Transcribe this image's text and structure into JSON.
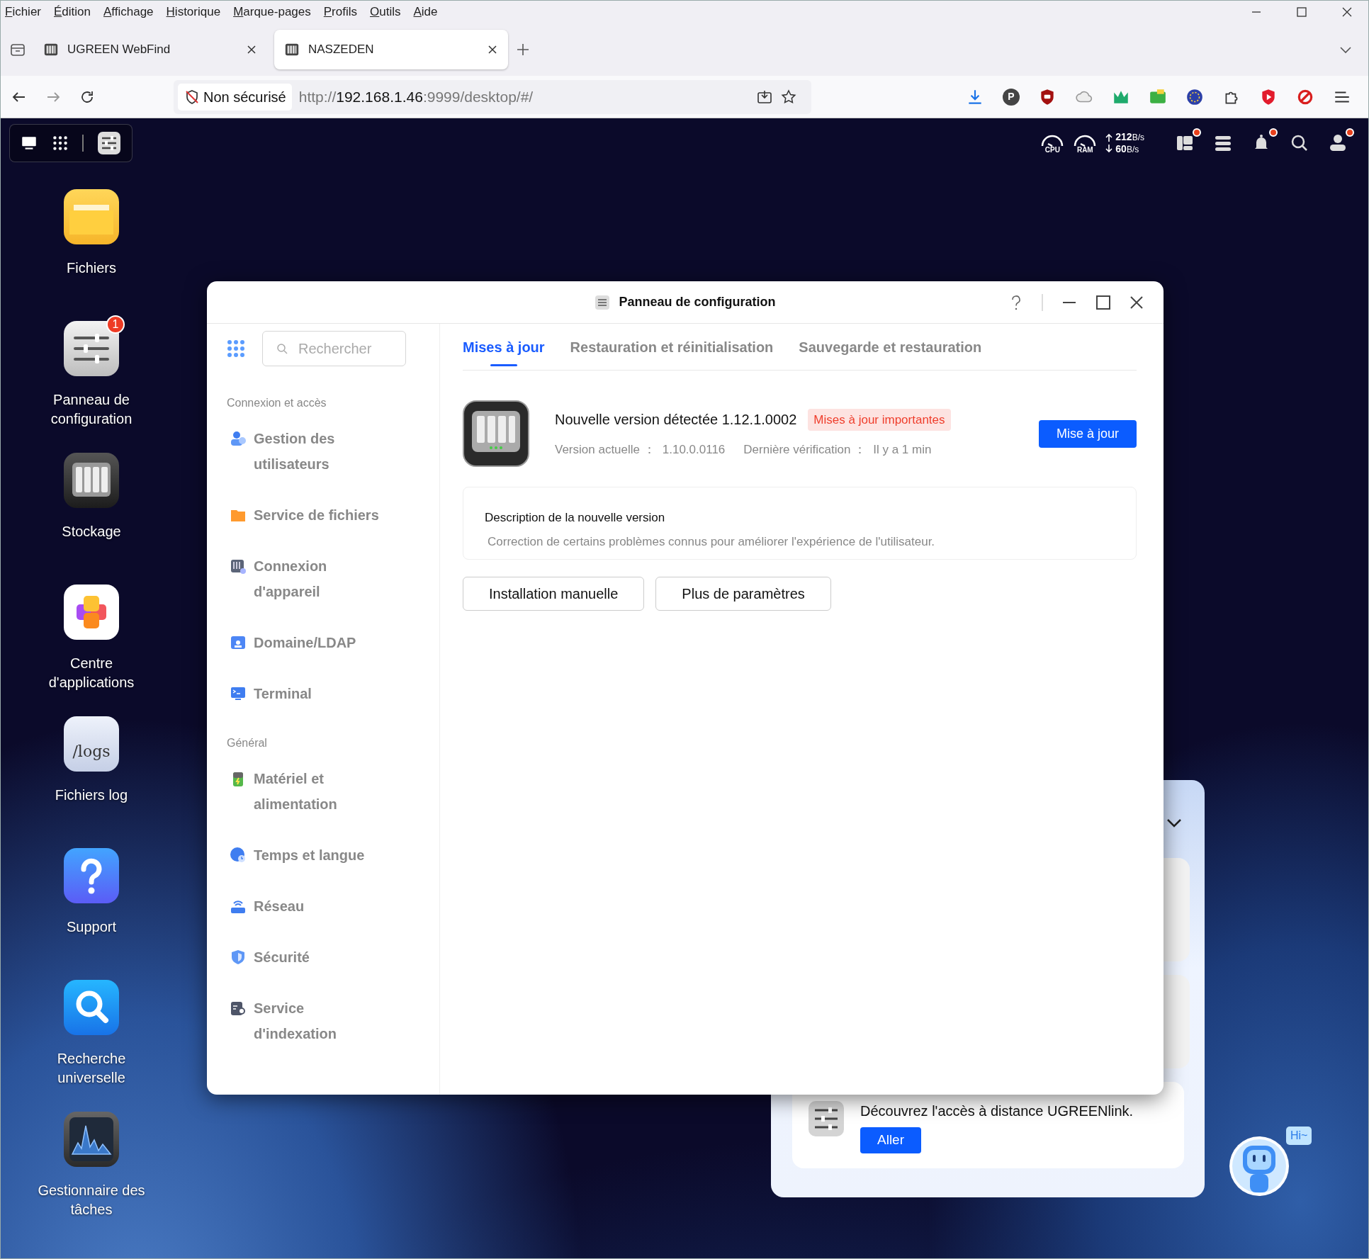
{
  "browser": {
    "menu": [
      "Fichier",
      "Édition",
      "Affichage",
      "Historique",
      "Marque-pages",
      "Profils",
      "Outils",
      "Aide"
    ],
    "tabs": [
      {
        "title": "UGREEN WebFind",
        "selected": false
      },
      {
        "title": "NASZEDEN",
        "selected": true
      }
    ],
    "security": "Non sécurisé",
    "url": {
      "scheme": "http://",
      "host": "192.168.1.46",
      "rest": ":9999/desktop/#/"
    },
    "extensions": [
      {
        "kind": "download"
      },
      {
        "kind": "letter",
        "label": "P"
      },
      {
        "kind": "shield"
      },
      {
        "kind": "cloud"
      },
      {
        "kind": "crown"
      },
      {
        "kind": "card"
      },
      {
        "kind": "globe"
      },
      {
        "kind": "puzzle"
      },
      {
        "kind": "play"
      },
      {
        "kind": "ring"
      },
      {
        "kind": "menu"
      }
    ]
  },
  "topbar": {
    "meters": [
      {
        "label": "CPU"
      },
      {
        "label": "RAM"
      }
    ],
    "upload": {
      "value": "212",
      "unit": "B/s"
    },
    "download": {
      "value": "60",
      "unit": "B/s"
    },
    "tray": [
      {
        "kind": "widgets",
        "badge": true
      },
      {
        "kind": "storage",
        "badge": false
      },
      {
        "kind": "bell",
        "badge": true
      },
      {
        "kind": "search",
        "badge": false
      },
      {
        "kind": "user",
        "badge": true
      }
    ]
  },
  "desktop_icons": [
    {
      "kind": "folder",
      "label": "Fichiers"
    },
    {
      "kind": "sliders",
      "label": "Panneau de configuration",
      "badge": "1"
    },
    {
      "kind": "nas",
      "label": "Stockage"
    },
    {
      "kind": "apps",
      "label": "Centre d'applications"
    },
    {
      "kind": "logs",
      "label": "Fichiers log",
      "icon_text": "/logs"
    },
    {
      "kind": "help",
      "label": "Support"
    },
    {
      "kind": "search",
      "label": "Recherche universelle"
    },
    {
      "kind": "chart",
      "label": "Gestionnaire des tâches"
    }
  ],
  "window": {
    "title": "Panneau de configuration",
    "search_placeholder": "Rechercher",
    "sidebar": [
      {
        "heading": "Connexion et accès",
        "items": [
          {
            "label": "Gestion des utilisateurs",
            "kind": "users"
          },
          {
            "label": "Service de fichiers",
            "kind": "folder"
          },
          {
            "label": "Connexion d'appareil",
            "kind": "nas"
          },
          {
            "label": "Domaine/LDAP",
            "kind": "domain"
          },
          {
            "label": "Terminal",
            "kind": "terminal"
          }
        ]
      },
      {
        "heading": "Général",
        "items": [
          {
            "label": "Matériel et alimentation",
            "kind": "battery"
          },
          {
            "label": "Temps et langue",
            "kind": "clock"
          },
          {
            "label": "Réseau",
            "kind": "router"
          },
          {
            "label": "Sécurité",
            "kind": "shield"
          },
          {
            "label": "Service d'indexation",
            "kind": "index"
          }
        ]
      }
    ],
    "tabs": [
      {
        "label": "Mises à jour",
        "selected": true
      },
      {
        "label": "Restauration et réinitialisation",
        "selected": false
      },
      {
        "label": "Sauvegarde et restauration",
        "selected": false
      }
    ],
    "update": {
      "title": "Nouvelle version détectée 1.12.1.0002",
      "tag": "Mises à jour importantes",
      "current_label": "Version actuelle ：",
      "current_value": "1.10.0.0116",
      "checked_label": "Dernière vérification ：",
      "checked_value": "Il y a 1 min",
      "button": "Mise à jour"
    },
    "description": {
      "title": "Description de la nouvelle version",
      "text": "Correction de certains problèmes connus pour améliorer l'expérience de l'utilisateur."
    },
    "buttons": [
      "Installation manuelle",
      "Plus de paramètres"
    ]
  },
  "notification_panel": {
    "message": "Découvrez l'accès à distance UGREENlink.",
    "button": "Aller"
  },
  "assistant": {
    "bubble": "Hi~"
  }
}
